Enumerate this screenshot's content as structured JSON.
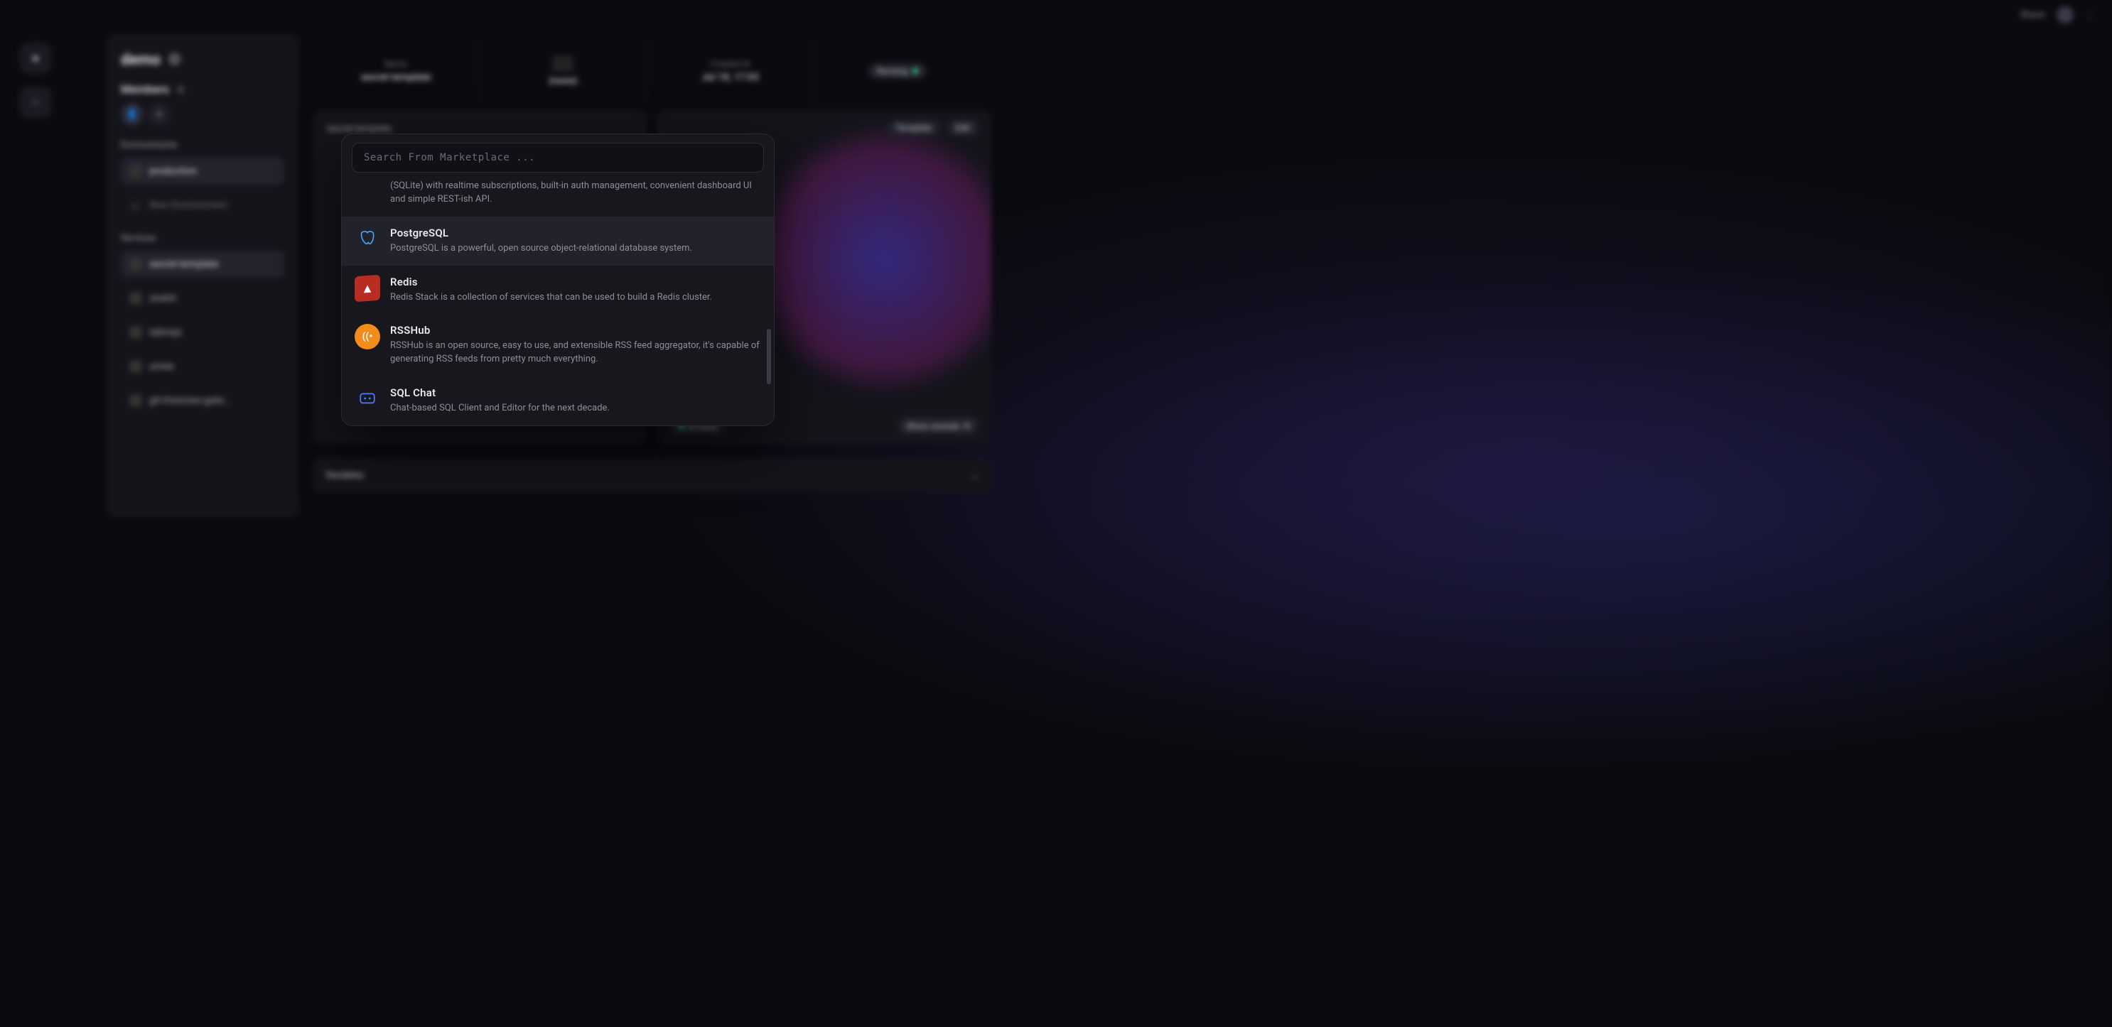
{
  "topbar": {
    "share": "Share"
  },
  "left_panel": {
    "title": "demo",
    "members_label": "Members",
    "add_btn_tooltip": "+",
    "sections": {
      "environments": "Environments",
      "services": "Services"
    },
    "environments": [
      {
        "name": "production",
        "active": true
      },
      {
        "name": "New Environment",
        "active": false,
        "is_add": true
      }
    ],
    "services": [
      {
        "name": "secret-template",
        "active": true
      },
      {
        "name": "zealot"
      },
      {
        "name": "tabrisjs"
      },
      {
        "name": "umee"
      },
      {
        "name": "git-histories-gate…"
      }
    ]
  },
  "main_header": {
    "col_name_label": "Name",
    "col_name_value": "secret-template",
    "col_source_label": "",
    "col_source_value": "(none)",
    "col_created_label": "Created At",
    "col_created_value": "Jul 18, 17:03",
    "running_label": "Running"
  },
  "cards": {
    "left_title": "secret-template",
    "right_title_chip": "Template",
    "right_edit": "Edit",
    "right_title_a": "",
    "right_title_b": "",
    "right_bottom_left": "● ready",
    "right_bottom_right": "Show console"
  },
  "var_strip": {
    "label": "Variables"
  },
  "marketplace": {
    "search_placeholder": "Search From Marketplace ...",
    "results": [
      {
        "title": "",
        "desc": "(SQLite) with realtime subscriptions, built-in auth management, convenient dashboard UI and simple REST-ish API.",
        "icon": "generic",
        "cutoff_top": true
      },
      {
        "title": "PostgreSQL",
        "desc": "PostgreSQL is a powerful, open source object-relational database system.",
        "icon": "postgres",
        "selected": true
      },
      {
        "title": "Redis",
        "desc": "Redis Stack is a collection of services that can be used to build a Redis cluster.",
        "icon": "redis"
      },
      {
        "title": "RSSHub",
        "desc": "RSSHub is an open source, easy to use, and extensible RSS feed aggregator, it's capable of generating RSS feeds from pretty much everything.",
        "icon": "rsshub"
      },
      {
        "title": "SQL Chat",
        "desc": "Chat-based SQL Client and Editor for the next decade.",
        "icon": "sqlchat"
      }
    ]
  }
}
